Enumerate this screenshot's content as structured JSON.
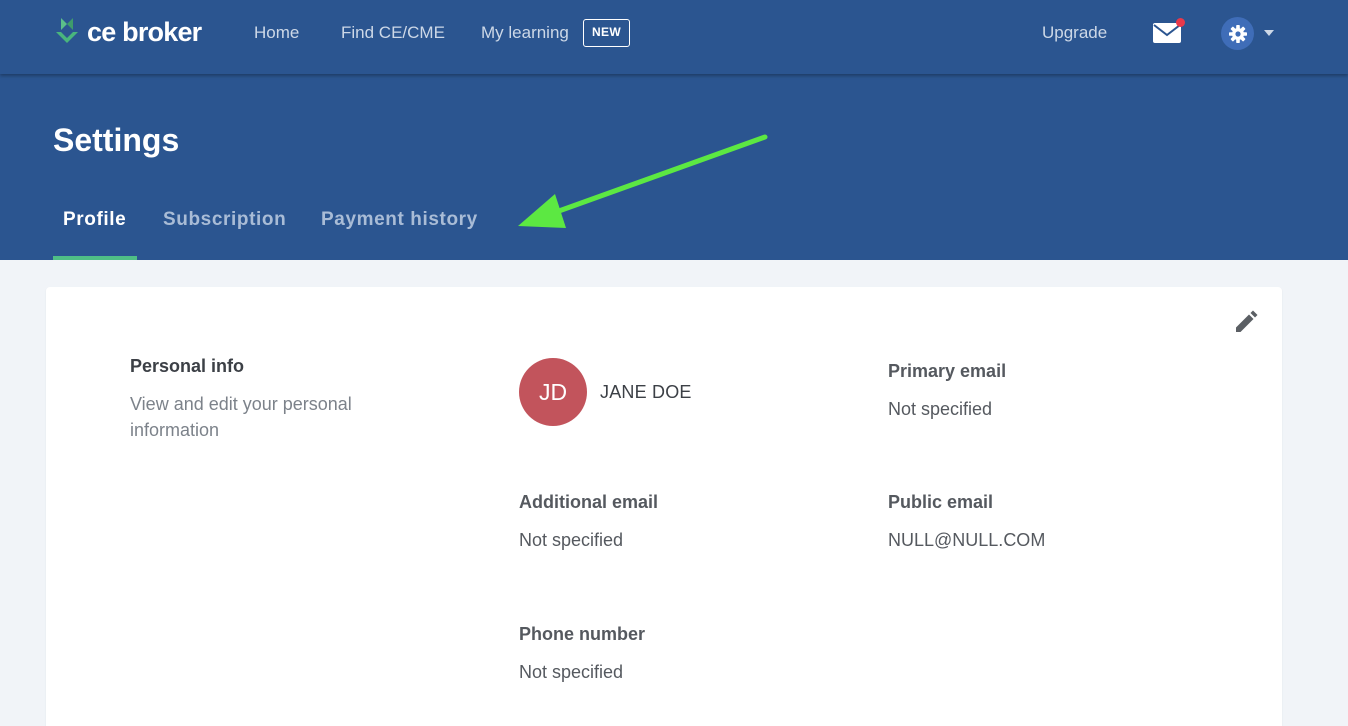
{
  "brand": {
    "logo_text": "ce broker",
    "colors": {
      "primary": "#2b5590",
      "accent": "#4fbf86",
      "avatar": "#c2545c",
      "annotation_arrow": "#5ce842"
    }
  },
  "nav": {
    "items": [
      {
        "label": "Home"
      },
      {
        "label": "Find CE/CME"
      },
      {
        "label": "My learning"
      }
    ],
    "new_badge": "NEW",
    "upgrade": "Upgrade",
    "icons": [
      "mail-icon",
      "gear-icon",
      "caret-down-icon"
    ]
  },
  "header": {
    "title": "Settings",
    "tabs": [
      {
        "label": "Profile",
        "active": true
      },
      {
        "label": "Subscription",
        "active": false
      },
      {
        "label": "Payment history",
        "active": false
      }
    ]
  },
  "profile": {
    "section_title": "Personal info",
    "section_description": "View and edit your personal information",
    "initials": "JD",
    "name": "JANE DOE",
    "fields": {
      "primary_email": {
        "label": "Primary email",
        "value": "Not specified"
      },
      "additional_email": {
        "label": "Additional email",
        "value": "Not specified"
      },
      "public_email": {
        "label": "Public email",
        "value": "NULL@NULL.COM"
      },
      "phone_number": {
        "label": "Phone number",
        "value": "Not specified"
      }
    },
    "edit_icon": "pencil-icon"
  }
}
